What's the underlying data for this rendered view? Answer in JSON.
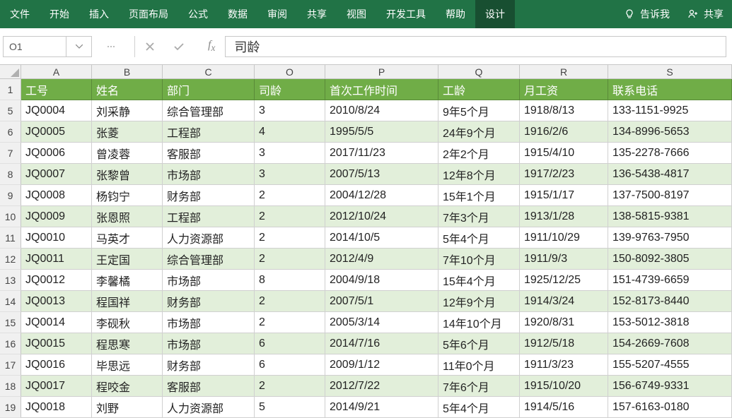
{
  "ribbon": {
    "tabs": [
      {
        "label": "文件"
      },
      {
        "label": "开始"
      },
      {
        "label": "插入"
      },
      {
        "label": "页面布局"
      },
      {
        "label": "公式"
      },
      {
        "label": "数据"
      },
      {
        "label": "审阅"
      },
      {
        "label": "共享"
      },
      {
        "label": "视图"
      },
      {
        "label": "开发工具"
      },
      {
        "label": "帮助"
      },
      {
        "label": "设计"
      }
    ],
    "active_index": 11,
    "tell_me": "告诉我",
    "share": "共享"
  },
  "formula_bar": {
    "name_box": "O1",
    "formula_value": "司龄"
  },
  "columns": [
    {
      "letter": "A",
      "cls": "cA"
    },
    {
      "letter": "B",
      "cls": "cB"
    },
    {
      "letter": "C",
      "cls": "cC"
    },
    {
      "letter": "O",
      "cls": "cO"
    },
    {
      "letter": "P",
      "cls": "cP"
    },
    {
      "letter": "Q",
      "cls": "cQ"
    },
    {
      "letter": "R",
      "cls": "cR"
    },
    {
      "letter": "S",
      "cls": "cS"
    }
  ],
  "row_numbers": [
    "1",
    "5",
    "6",
    "7",
    "8",
    "9",
    "10",
    "11",
    "12",
    "13",
    "14",
    "15",
    "16",
    "17",
    "18",
    "19"
  ],
  "header_row": [
    "工号",
    "姓名",
    "部门",
    "司龄",
    "首次工作时间",
    "工龄",
    "月工资",
    "联系电话"
  ],
  "rows": [
    [
      "JQ0004",
      "刘采静",
      "综合管理部",
      "3",
      "2010/8/24",
      "9年5个月",
      "1918/8/13",
      "133-1151-9925"
    ],
    [
      "JQ0005",
      "张菱",
      "工程部",
      "4",
      "1995/5/5",
      "24年9个月",
      "1916/2/6",
      "134-8996-5653"
    ],
    [
      "JQ0006",
      "曾凌蓉",
      "客服部",
      "3",
      "2017/11/23",
      "2年2个月",
      "1915/4/10",
      "135-2278-7666"
    ],
    [
      "JQ0007",
      "张黎曾",
      "市场部",
      "3",
      "2007/5/13",
      "12年8个月",
      "1917/2/23",
      "136-5438-4817"
    ],
    [
      "JQ0008",
      "杨钧宁",
      "财务部",
      "2",
      "2004/12/28",
      "15年1个月",
      "1915/1/17",
      "137-7500-8197"
    ],
    [
      "JQ0009",
      "张恩照",
      "工程部",
      "2",
      "2012/10/24",
      "7年3个月",
      "1913/1/28",
      "138-5815-9381"
    ],
    [
      "JQ0010",
      "马英才",
      "人力资源部",
      "2",
      "2014/10/5",
      "5年4个月",
      "1911/10/29",
      "139-9763-7950"
    ],
    [
      "JQ0011",
      "王定国",
      "综合管理部",
      "2",
      "2012/4/9",
      "7年10个月",
      "1911/9/3",
      "150-8092-3805"
    ],
    [
      "JQ0012",
      "李馨橘",
      "市场部",
      "8",
      "2004/9/18",
      "15年4个月",
      "1925/12/25",
      "151-4739-6659"
    ],
    [
      "JQ0013",
      "程国祥",
      "财务部",
      "2",
      "2007/5/1",
      "12年9个月",
      "1914/3/24",
      "152-8173-8440"
    ],
    [
      "JQ0014",
      "李砚秋",
      "市场部",
      "2",
      "2005/3/14",
      "14年10个月",
      "1920/8/31",
      "153-5012-3818"
    ],
    [
      "JQ0015",
      "程思寒",
      "市场部",
      "6",
      "2014/7/16",
      "5年6个月",
      "1912/5/18",
      "154-2669-7608"
    ],
    [
      "JQ0016",
      "毕思远",
      "财务部",
      "6",
      "2009/1/12",
      "11年0个月",
      "1911/3/23",
      "155-5207-4555"
    ],
    [
      "JQ0017",
      "程咬金",
      "客服部",
      "2",
      "2012/7/22",
      "7年6个月",
      "1915/10/20",
      "156-6749-9331"
    ],
    [
      "JQ0018",
      "刘野",
      "人力资源部",
      "5",
      "2014/9/21",
      "5年4个月",
      "1914/5/16",
      "157-6163-0180"
    ]
  ]
}
